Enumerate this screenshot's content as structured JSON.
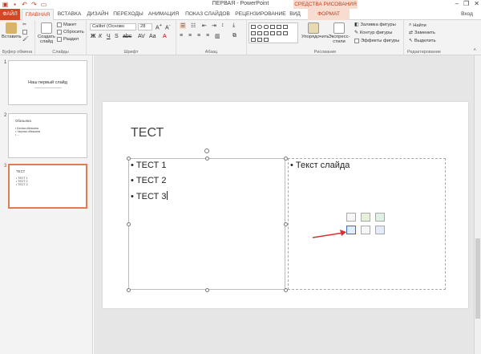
{
  "window": {
    "title": "ПЕРВАЯ - PowerPoint",
    "context_tools": "СРЕДСТВА РИСОВАНИЯ",
    "user": "Вход",
    "minimize": "–",
    "restore": "❐",
    "close": "✕"
  },
  "tabs": [
    {
      "label": "ФАЙЛ"
    },
    {
      "label": "ГЛАВНАЯ"
    },
    {
      "label": "ВСТАВКА"
    },
    {
      "label": "ДИЗАЙН"
    },
    {
      "label": "ПЕРЕХОДЫ"
    },
    {
      "label": "АНИМАЦИЯ"
    },
    {
      "label": "ПОКАЗ СЛАЙДОВ"
    },
    {
      "label": "РЕЦЕНЗИРОВАНИЕ"
    },
    {
      "label": "ВИД"
    },
    {
      "label": "ФОРМАТ"
    }
  ],
  "ribbon": {
    "clipboard": {
      "paste": "Вставить",
      "group": "Буфер обмена"
    },
    "slides": {
      "new_slide": "Создать слайд",
      "layout": "Макет",
      "reset": "Сбросить",
      "section": "Раздел",
      "group": "Слайды"
    },
    "font": {
      "name": "Calibri (Основн",
      "size": "28",
      "group": "Шрифт"
    },
    "paragraph": {
      "group": "Абзац"
    },
    "drawing": {
      "arrange": "Упорядочить",
      "quick_styles": "Экспресс-стили",
      "fill": "Заливка фигуры",
      "outline": "Контур фигуры",
      "effects": "Эффекты фигуры",
      "group": "Рисование"
    },
    "editing": {
      "find": "Найти",
      "replace": "Заменить",
      "select": "Выделить",
      "group": "Редактирование"
    }
  },
  "thumbnails": [
    {
      "num": "1",
      "title": "Наш первый слайд"
    },
    {
      "num": "2",
      "title": "Обезьяна",
      "lines": [
        "• Белая обезьяна",
        "• Черная обезьяна",
        "• ..."
      ]
    },
    {
      "num": "3",
      "title": "ТЕСТ",
      "lines": [
        "• ТЕСТ 1",
        "• ТЕСТ 2",
        "• ТЕСТ 3"
      ]
    }
  ],
  "slide": {
    "title": "ТЕСТ",
    "left_bullets": [
      "• ТЕСТ 1",
      "• ТЕСТ 2",
      "• ТЕСТ 3"
    ],
    "right_bullet": "• Текст слайда"
  },
  "colors": {
    "accent": "#d24726",
    "arrow": "#d9302b",
    "selected_thumb": "#e07b53"
  }
}
